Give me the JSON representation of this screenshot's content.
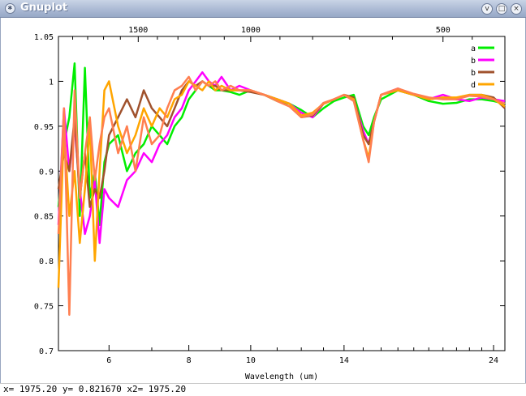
{
  "window": {
    "title": "Gnuplot",
    "minimize_glyph": "v",
    "maximize_glyph": "□",
    "close_glyph": "×",
    "icon": "gnuplot-app-icon"
  },
  "status_text": "x= 1975.20 y= 0.821670 x2= 1975.20",
  "chart_data": {
    "type": "line",
    "xlabel": "Wavelength (um)",
    "ylabel": "",
    "title": "",
    "x_scale": "log",
    "xlim": [
      5.0,
      25.0
    ],
    "ylim": [
      0.7,
      1.05
    ],
    "grid": false,
    "legend_position": "top-right",
    "x_ticks": [
      6,
      8,
      10,
      14,
      24
    ],
    "x_tick_labels": [
      "6",
      "8",
      "10",
      "14",
      "24"
    ],
    "x2_ticks": [
      1500,
      1000,
      500
    ],
    "x2_tick_labels": [
      "1500",
      "1000",
      "500"
    ],
    "x2_note": "top axis in wavenumber (1/cm) = 10000 / wavelength",
    "y_ticks": [
      0.7,
      0.75,
      0.8,
      0.85,
      0.9,
      0.95,
      1.0,
      1.05
    ],
    "y_tick_labels": [
      "0.7",
      "0.75",
      "0.8",
      "0.85",
      "0.9",
      "0.95",
      "1",
      "1.05"
    ],
    "series": [
      {
        "name": "a",
        "color": "#00ee00",
        "x": [
          5.0,
          5.1,
          5.2,
          5.3,
          5.4,
          5.5,
          5.6,
          5.7,
          5.8,
          5.9,
          6.0,
          6.2,
          6.4,
          6.6,
          6.8,
          7.0,
          7.2,
          7.4,
          7.6,
          7.8,
          8.0,
          8.2,
          8.4,
          8.6,
          8.8,
          9.0,
          9.3,
          9.6,
          10.0,
          10.5,
          11.0,
          11.5,
          12.0,
          12.5,
          13.0,
          13.5,
          14.0,
          14.5,
          15.0,
          15.3,
          15.6,
          16.0,
          17.0,
          18.0,
          19.0,
          20.0,
          21.0,
          22.0,
          23.0,
          24.0,
          25.0
        ],
        "y": [
          0.86,
          0.93,
          0.96,
          1.02,
          0.85,
          1.015,
          0.87,
          0.9,
          0.84,
          0.91,
          0.93,
          0.94,
          0.9,
          0.92,
          0.93,
          0.95,
          0.94,
          0.93,
          0.95,
          0.96,
          0.98,
          0.99,
          1.0,
          0.995,
          0.99,
          0.99,
          0.988,
          0.985,
          0.99,
          0.985,
          0.978,
          0.975,
          0.968,
          0.96,
          0.97,
          0.978,
          0.982,
          0.985,
          0.95,
          0.94,
          0.96,
          0.98,
          0.99,
          0.985,
          0.978,
          0.975,
          0.976,
          0.98,
          0.98,
          0.978,
          0.975
        ]
      },
      {
        "name": "b",
        "color": "#ff00ff",
        "x": [
          5.0,
          5.1,
          5.2,
          5.3,
          5.4,
          5.5,
          5.6,
          5.7,
          5.8,
          5.9,
          6.0,
          6.2,
          6.4,
          6.6,
          6.8,
          7.0,
          7.2,
          7.4,
          7.6,
          7.8,
          8.0,
          8.2,
          8.4,
          8.6,
          8.8,
          9.0,
          9.3,
          9.6,
          10.0,
          10.5,
          11.0,
          11.5,
          12.0,
          12.5,
          13.0,
          13.5,
          14.0,
          14.5,
          15.0,
          15.3,
          15.6,
          16.0,
          17.0,
          18.0,
          19.0,
          20.0,
          21.0,
          22.0,
          23.0,
          24.0,
          25.0
        ],
        "y": [
          0.84,
          0.97,
          0.9,
          0.95,
          0.88,
          0.83,
          0.85,
          0.89,
          0.82,
          0.88,
          0.87,
          0.86,
          0.89,
          0.9,
          0.92,
          0.91,
          0.93,
          0.94,
          0.96,
          0.97,
          0.99,
          1.0,
          1.01,
          1.0,
          0.995,
          1.005,
          0.99,
          0.995,
          0.99,
          0.985,
          0.98,
          0.975,
          0.965,
          0.96,
          0.975,
          0.98,
          0.985,
          0.98,
          0.945,
          0.93,
          0.955,
          0.985,
          0.992,
          0.985,
          0.98,
          0.985,
          0.98,
          0.978,
          0.982,
          0.98,
          0.978
        ]
      },
      {
        "name": "b",
        "color": "#a0522d",
        "x": [
          5.0,
          5.1,
          5.2,
          5.3,
          5.4,
          5.5,
          5.6,
          5.7,
          5.8,
          5.9,
          6.0,
          6.2,
          6.4,
          6.6,
          6.8,
          7.0,
          7.2,
          7.4,
          7.6,
          7.8,
          8.0,
          8.2,
          8.4,
          8.6,
          8.8,
          9.0,
          9.3,
          9.6,
          10.0,
          10.5,
          11.0,
          11.5,
          12.0,
          12.5,
          13.0,
          13.5,
          14.0,
          14.5,
          15.0,
          15.3,
          15.6,
          16.0,
          17.0,
          18.0,
          19.0,
          20.0,
          21.0,
          22.0,
          23.0,
          24.0,
          25.0
        ],
        "y": [
          0.88,
          0.92,
          0.9,
          0.96,
          0.87,
          0.92,
          0.86,
          0.88,
          0.87,
          0.9,
          0.94,
          0.96,
          0.98,
          0.96,
          0.99,
          0.97,
          0.96,
          0.95,
          0.97,
          0.99,
          1.0,
          0.995,
          1.0,
          0.995,
          0.995,
          0.99,
          0.99,
          0.99,
          0.988,
          0.985,
          0.98,
          0.975,
          0.96,
          0.962,
          0.975,
          0.98,
          0.985,
          0.982,
          0.94,
          0.93,
          0.955,
          0.985,
          0.99,
          0.985,
          0.98,
          0.982,
          0.98,
          0.985,
          0.985,
          0.982,
          0.97
        ]
      },
      {
        "name": "d",
        "color": "#ffa500",
        "x": [
          5.0,
          5.1,
          5.2,
          5.3,
          5.4,
          5.5,
          5.6,
          5.7,
          5.8,
          5.9,
          6.0,
          6.2,
          6.4,
          6.6,
          6.8,
          7.0,
          7.2,
          7.4,
          7.6,
          7.8,
          8.0,
          8.2,
          8.4,
          8.6,
          8.8,
          9.0,
          9.3,
          9.6,
          10.0,
          10.5,
          11.0,
          11.5,
          12.0,
          12.5,
          13.0,
          13.5,
          14.0,
          14.5,
          15.0,
          15.3,
          15.6,
          16.0,
          17.0,
          18.0,
          19.0,
          20.0,
          21.0,
          22.0,
          23.0,
          24.0,
          25.0
        ],
        "y": [
          0.77,
          0.95,
          0.85,
          0.9,
          0.82,
          0.88,
          0.95,
          0.8,
          0.9,
          0.99,
          1.0,
          0.95,
          0.92,
          0.94,
          0.97,
          0.95,
          0.97,
          0.96,
          0.98,
          0.985,
          1.0,
          0.995,
          0.99,
          1.0,
          0.99,
          0.995,
          0.99,
          0.99,
          0.99,
          0.985,
          0.98,
          0.975,
          0.962,
          0.965,
          0.975,
          0.98,
          0.985,
          0.98,
          0.935,
          0.915,
          0.955,
          0.985,
          0.99,
          0.985,
          0.98,
          0.982,
          0.982,
          0.985,
          0.985,
          0.98,
          0.972
        ]
      },
      {
        "name": "",
        "color": "#ff7f50",
        "x": [
          5.0,
          5.1,
          5.2,
          5.3,
          5.4,
          5.5,
          5.6,
          5.7,
          5.8,
          5.9,
          6.0,
          6.2,
          6.4,
          6.6,
          6.8,
          7.0,
          7.2,
          7.4,
          7.6,
          7.8,
          8.0,
          8.2,
          8.4,
          8.6,
          8.8,
          9.0,
          9.3,
          9.6,
          10.0,
          10.5,
          11.0,
          11.5,
          12.0,
          12.5,
          13.0,
          13.5,
          14.0,
          14.5,
          15.0,
          15.3,
          15.6,
          16.0,
          17.0,
          18.0,
          19.0,
          20.0,
          21.0,
          22.0,
          23.0,
          24.0,
          25.0
        ],
        "y": [
          0.83,
          0.97,
          0.74,
          0.99,
          0.87,
          0.92,
          0.96,
          0.89,
          0.93,
          0.96,
          0.97,
          0.92,
          0.95,
          0.9,
          0.96,
          0.93,
          0.94,
          0.97,
          0.99,
          0.995,
          1.005,
          0.99,
          1.0,
          0.995,
          1.0,
          0.99,
          0.995,
          0.99,
          0.99,
          0.985,
          0.978,
          0.972,
          0.96,
          0.963,
          0.976,
          0.98,
          0.985,
          0.978,
          0.935,
          0.91,
          0.955,
          0.985,
          0.992,
          0.986,
          0.982,
          0.98,
          0.98,
          0.984,
          0.983,
          0.98,
          0.975
        ]
      }
    ]
  }
}
